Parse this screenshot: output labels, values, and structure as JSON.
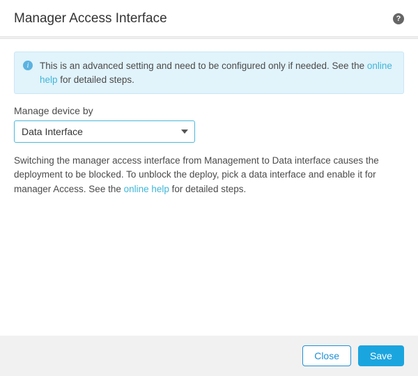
{
  "header": {
    "title": "Manager Access Interface",
    "help_icon": "?"
  },
  "banner": {
    "icon_glyph": "i",
    "text_before_link": "This is an advanced setting and need to be configured only if needed. See the ",
    "link": "online help",
    "text_after_link": " for detailed steps."
  },
  "field": {
    "label": "Manage device by",
    "value": "Data Interface"
  },
  "description": {
    "text_before_link": "Switching the manager access interface from Management to Data interface causes the deployment to be blocked. To unblock the deploy, pick a data interface and enable it for manager Access. See the ",
    "link": "online help",
    "text_after_link": " for detailed steps."
  },
  "footer": {
    "close": "Close",
    "save": "Save"
  }
}
